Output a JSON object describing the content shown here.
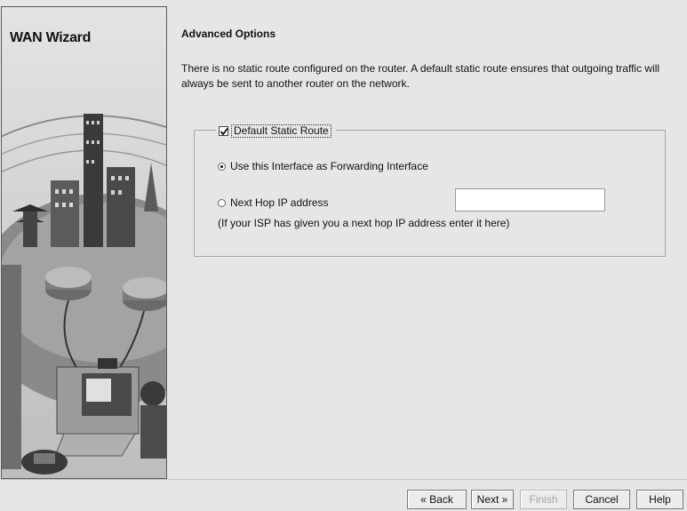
{
  "sidebar": {
    "brand_title": "WAN Wizard"
  },
  "page": {
    "title": "Advanced Options",
    "description": "There is no static route configured on the router. A default static route ensures that outgoing traffic will always be sent to another router on the network."
  },
  "route_group": {
    "legend_label": "Default Static Route",
    "legend_checked": true,
    "use_interface_label": "Use this Interface as Forwarding Interface",
    "use_interface_selected": true,
    "next_hop_label": "Next Hop IP address",
    "next_hop_selected": false,
    "next_hop_value": "",
    "hint": "(If your ISP has given you a next hop IP address enter it here)"
  },
  "buttons": {
    "back": "« Back",
    "next": "Next »",
    "finish": "Finish",
    "cancel": "Cancel",
    "help": "Help"
  }
}
